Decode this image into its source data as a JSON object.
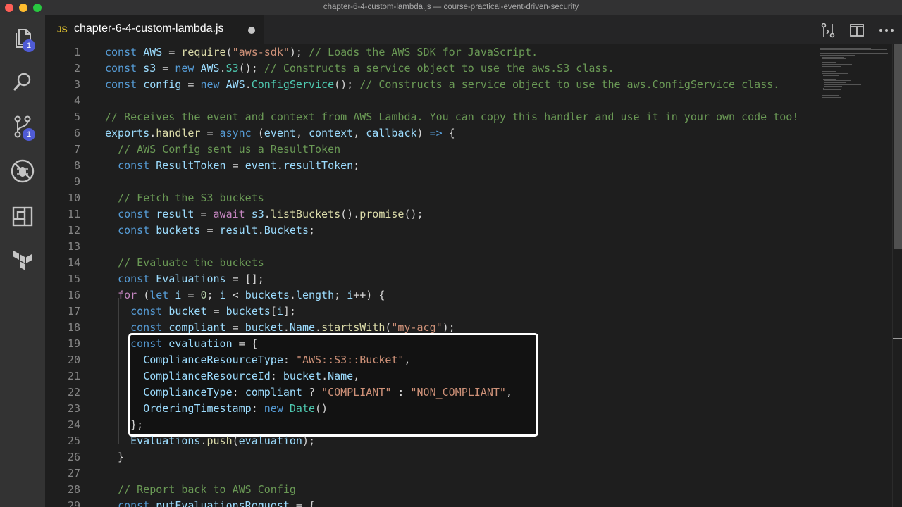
{
  "window": {
    "title": "chapter-6-4-custom-lambda.js — course-practical-event-driven-security"
  },
  "activity_bar": {
    "items": [
      {
        "name": "explorer",
        "icon": "files-icon",
        "badge": "1"
      },
      {
        "name": "search",
        "icon": "search-icon",
        "badge": ""
      },
      {
        "name": "source-control",
        "icon": "source-control-icon",
        "badge": "1"
      },
      {
        "name": "debug",
        "icon": "no-bug-icon",
        "badge": ""
      },
      {
        "name": "extensions",
        "icon": "extensions-icon",
        "badge": ""
      },
      {
        "name": "terraform",
        "icon": "terraform-icon",
        "badge": ""
      }
    ]
  },
  "tab": {
    "lang": "JS",
    "filename": "chapter-6-4-custom-lambda.js",
    "dirty": true
  },
  "top_actions": [
    {
      "icon": "open-changes-icon"
    },
    {
      "icon": "split-editor-icon"
    },
    {
      "icon": "more-actions-icon"
    }
  ],
  "code": {
    "lines": [
      {
        "n": "1",
        "tokens": [
          [
            "kw",
            "const "
          ],
          [
            "var",
            "AWS"
          ],
          [
            "plain",
            " = "
          ],
          [
            "fn",
            "require"
          ],
          [
            "plain",
            "("
          ],
          [
            "str",
            "\"aws-sdk\""
          ],
          [
            "plain",
            "); "
          ],
          [
            "cmt",
            "// Loads the AWS SDK for JavaScript."
          ]
        ]
      },
      {
        "n": "2",
        "tokens": [
          [
            "kw",
            "const "
          ],
          [
            "var",
            "s3"
          ],
          [
            "plain",
            " = "
          ],
          [
            "kw",
            "new "
          ],
          [
            "var",
            "AWS"
          ],
          [
            "plain",
            "."
          ],
          [
            "cls",
            "S3"
          ],
          [
            "plain",
            "(); "
          ],
          [
            "cmt",
            "// Constructs a service object to use the aws.S3 class."
          ]
        ]
      },
      {
        "n": "3",
        "tokens": [
          [
            "kw",
            "const "
          ],
          [
            "var",
            "config"
          ],
          [
            "plain",
            " = "
          ],
          [
            "kw",
            "new "
          ],
          [
            "var",
            "AWS"
          ],
          [
            "plain",
            "."
          ],
          [
            "cls",
            "ConfigService"
          ],
          [
            "plain",
            "(); "
          ],
          [
            "cmt",
            "// Constructs a service object to use the aws.ConfigService class."
          ]
        ]
      },
      {
        "n": "4",
        "tokens": []
      },
      {
        "n": "5",
        "tokens": [
          [
            "cmt",
            "// Receives the event and context from AWS Lambda. You can copy this handler and use it in your own code too!"
          ]
        ]
      },
      {
        "n": "6",
        "tokens": [
          [
            "var",
            "exports"
          ],
          [
            "plain",
            "."
          ],
          [
            "fn",
            "handler"
          ],
          [
            "plain",
            " = "
          ],
          [
            "kw",
            "async "
          ],
          [
            "plain",
            "("
          ],
          [
            "var",
            "event"
          ],
          [
            "plain",
            ", "
          ],
          [
            "var",
            "context"
          ],
          [
            "plain",
            ", "
          ],
          [
            "var",
            "callback"
          ],
          [
            "plain",
            ") "
          ],
          [
            "kw",
            "=>"
          ],
          [
            "plain",
            " {"
          ]
        ]
      },
      {
        "n": "7",
        "tokens": [
          [
            "plain",
            "  "
          ],
          [
            "cmt",
            "// AWS Config sent us a ResultToken"
          ]
        ]
      },
      {
        "n": "8",
        "tokens": [
          [
            "plain",
            "  "
          ],
          [
            "kw",
            "const "
          ],
          [
            "var",
            "ResultToken"
          ],
          [
            "plain",
            " = "
          ],
          [
            "var",
            "event"
          ],
          [
            "plain",
            "."
          ],
          [
            "var",
            "resultToken"
          ],
          [
            "plain",
            ";"
          ]
        ]
      },
      {
        "n": "9",
        "tokens": []
      },
      {
        "n": "10",
        "tokens": [
          [
            "plain",
            "  "
          ],
          [
            "cmt",
            "// Fetch the S3 buckets"
          ]
        ]
      },
      {
        "n": "11",
        "tokens": [
          [
            "plain",
            "  "
          ],
          [
            "kw",
            "const "
          ],
          [
            "var",
            "result"
          ],
          [
            "plain",
            " = "
          ],
          [
            "ctrl",
            "await "
          ],
          [
            "var",
            "s3"
          ],
          [
            "plain",
            "."
          ],
          [
            "fn",
            "listBuckets"
          ],
          [
            "plain",
            "()."
          ],
          [
            "fn",
            "promise"
          ],
          [
            "plain",
            "();"
          ]
        ]
      },
      {
        "n": "12",
        "tokens": [
          [
            "plain",
            "  "
          ],
          [
            "kw",
            "const "
          ],
          [
            "var",
            "buckets"
          ],
          [
            "plain",
            " = "
          ],
          [
            "var",
            "result"
          ],
          [
            "plain",
            "."
          ],
          [
            "var",
            "Buckets"
          ],
          [
            "plain",
            ";"
          ]
        ]
      },
      {
        "n": "13",
        "tokens": []
      },
      {
        "n": "14",
        "tokens": [
          [
            "plain",
            "  "
          ],
          [
            "cmt",
            "// Evaluate the buckets"
          ]
        ]
      },
      {
        "n": "15",
        "tokens": [
          [
            "plain",
            "  "
          ],
          [
            "kw",
            "const "
          ],
          [
            "var",
            "Evaluations"
          ],
          [
            "plain",
            " = [];"
          ]
        ]
      },
      {
        "n": "16",
        "tokens": [
          [
            "plain",
            "  "
          ],
          [
            "ctrl",
            "for "
          ],
          [
            "plain",
            "("
          ],
          [
            "kw",
            "let "
          ],
          [
            "var",
            "i"
          ],
          [
            "plain",
            " = "
          ],
          [
            "num",
            "0"
          ],
          [
            "plain",
            "; "
          ],
          [
            "var",
            "i"
          ],
          [
            "plain",
            " < "
          ],
          [
            "var",
            "buckets"
          ],
          [
            "plain",
            "."
          ],
          [
            "var",
            "length"
          ],
          [
            "plain",
            "; "
          ],
          [
            "var",
            "i"
          ],
          [
            "plain",
            "++) {"
          ]
        ]
      },
      {
        "n": "17",
        "tokens": [
          [
            "plain",
            "    "
          ],
          [
            "kw",
            "const "
          ],
          [
            "var",
            "bucket"
          ],
          [
            "plain",
            " = "
          ],
          [
            "var",
            "buckets"
          ],
          [
            "plain",
            "["
          ],
          [
            "var",
            "i"
          ],
          [
            "plain",
            "];"
          ]
        ]
      },
      {
        "n": "18",
        "tokens": [
          [
            "plain",
            "    "
          ],
          [
            "kw",
            "const "
          ],
          [
            "var",
            "compliant"
          ],
          [
            "plain",
            " = "
          ],
          [
            "var",
            "bucket"
          ],
          [
            "plain",
            "."
          ],
          [
            "var",
            "Name"
          ],
          [
            "plain",
            "."
          ],
          [
            "fn",
            "startsWith"
          ],
          [
            "plain",
            "("
          ],
          [
            "str",
            "\"my-acg\""
          ],
          [
            "plain",
            ");"
          ]
        ]
      },
      {
        "n": "19",
        "tokens": [
          [
            "plain",
            "    "
          ],
          [
            "kw",
            "const "
          ],
          [
            "var",
            "evaluation"
          ],
          [
            "plain",
            " = {"
          ]
        ]
      },
      {
        "n": "20",
        "tokens": [
          [
            "plain",
            "      "
          ],
          [
            "var",
            "ComplianceResourceType"
          ],
          [
            "plain",
            ": "
          ],
          [
            "str",
            "\"AWS::S3::Bucket\""
          ],
          [
            "plain",
            ","
          ]
        ]
      },
      {
        "n": "21",
        "tokens": [
          [
            "plain",
            "      "
          ],
          [
            "var",
            "ComplianceResourceId"
          ],
          [
            "plain",
            ": "
          ],
          [
            "var",
            "bucket"
          ],
          [
            "plain",
            "."
          ],
          [
            "var",
            "Name"
          ],
          [
            "plain",
            ","
          ]
        ]
      },
      {
        "n": "22",
        "tokens": [
          [
            "plain",
            "      "
          ],
          [
            "var",
            "ComplianceType"
          ],
          [
            "plain",
            ": "
          ],
          [
            "var",
            "compliant"
          ],
          [
            "plain",
            " ? "
          ],
          [
            "str",
            "\"COMPLIANT\""
          ],
          [
            "plain",
            " : "
          ],
          [
            "str",
            "\"NON_COMPLIANT\""
          ],
          [
            "plain",
            ","
          ]
        ]
      },
      {
        "n": "23",
        "tokens": [
          [
            "plain",
            "      "
          ],
          [
            "var",
            "OrderingTimestamp"
          ],
          [
            "plain",
            ": "
          ],
          [
            "kw",
            "new "
          ],
          [
            "cls",
            "Date"
          ],
          [
            "plain",
            "()"
          ]
        ]
      },
      {
        "n": "24",
        "tokens": [
          [
            "plain",
            "    };"
          ]
        ]
      },
      {
        "n": "25",
        "tokens": [
          [
            "plain",
            "    "
          ],
          [
            "var",
            "Evaluations"
          ],
          [
            "plain",
            "."
          ],
          [
            "fn",
            "push"
          ],
          [
            "plain",
            "("
          ],
          [
            "var",
            "evaluation"
          ],
          [
            "plain",
            ");"
          ]
        ]
      },
      {
        "n": "26",
        "tokens": [
          [
            "plain",
            "  }"
          ]
        ]
      },
      {
        "n": "27",
        "tokens": []
      },
      {
        "n": "28",
        "tokens": [
          [
            "plain",
            "  "
          ],
          [
            "cmt",
            "// Report back to AWS Config"
          ]
        ]
      },
      {
        "n": "29",
        "tokens": [
          [
            "plain",
            "  "
          ],
          [
            "kw",
            "const "
          ],
          [
            "var",
            "putEvaluationsRequest"
          ],
          [
            "plain",
            " = {"
          ]
        ]
      }
    ]
  }
}
